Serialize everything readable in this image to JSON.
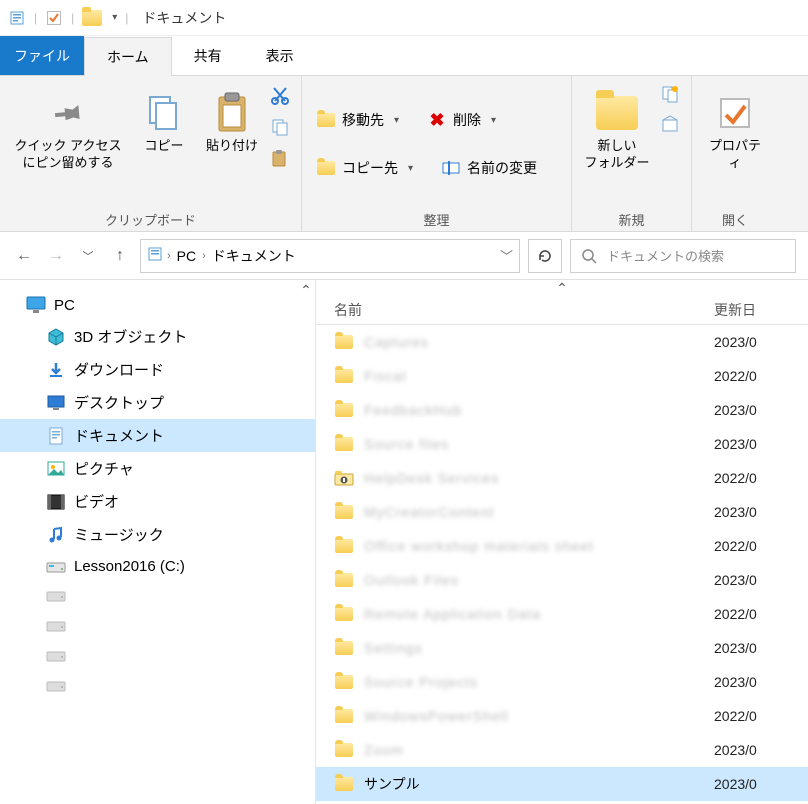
{
  "titlebar": {
    "title": "ドキュメント"
  },
  "tabs": {
    "file": "ファイル",
    "home": "ホーム",
    "share": "共有",
    "view": "表示"
  },
  "ribbon": {
    "clipboard": {
      "pin": "クイック アクセス\nにピン留めする",
      "copy": "コピー",
      "paste": "貼り付け",
      "group_label": "クリップボード"
    },
    "organize": {
      "move_to": "移動先",
      "copy_to": "コピー先",
      "delete": "削除",
      "rename": "名前の変更",
      "group_label": "整理"
    },
    "new": {
      "new_folder": "新しい\nフォルダー",
      "group_label": "新規"
    },
    "open": {
      "properties": "プロパティ",
      "group_label": "開く"
    }
  },
  "breadcrumb": {
    "root": "PC",
    "current": "ドキュメント"
  },
  "search": {
    "placeholder": "ドキュメントの検索"
  },
  "tree": {
    "pc": "PC",
    "items": [
      {
        "label": "3D オブジェクト",
        "icon": "cube"
      },
      {
        "label": "ダウンロード",
        "icon": "download"
      },
      {
        "label": "デスクトップ",
        "icon": "desktop"
      },
      {
        "label": "ドキュメント",
        "icon": "document",
        "selected": true
      },
      {
        "label": "ピクチャ",
        "icon": "pictures"
      },
      {
        "label": "ビデオ",
        "icon": "video"
      },
      {
        "label": "ミュージック",
        "icon": "music"
      },
      {
        "label": "Lesson2016 (C:)",
        "icon": "drive"
      },
      {
        "label": "",
        "icon": "drive-gray"
      },
      {
        "label": "",
        "icon": "drive-gray"
      },
      {
        "label": "",
        "icon": "drive-gray"
      },
      {
        "label": "",
        "icon": "drive-gray"
      }
    ]
  },
  "columns": {
    "name": "名前",
    "modified": "更新日"
  },
  "files": [
    {
      "name": "Captures",
      "date": "2023/0",
      "blurred": true,
      "icon": "folder"
    },
    {
      "name": "Fiscal",
      "date": "2022/0",
      "blurred": true,
      "icon": "folder"
    },
    {
      "name": "FeedbackHub",
      "date": "2023/0",
      "blurred": true,
      "icon": "folder"
    },
    {
      "name": "Source files",
      "date": "2023/0",
      "blurred": true,
      "icon": "folder"
    },
    {
      "name": "HelpDesk Services",
      "date": "2022/0",
      "blurred": true,
      "icon": "folder-special"
    },
    {
      "name": "MyCreatorContent",
      "date": "2023/0",
      "blurred": true,
      "icon": "folder"
    },
    {
      "name": "Office workshop materials sheet",
      "date": "2022/0",
      "blurred": true,
      "icon": "folder"
    },
    {
      "name": "Outlook Files",
      "date": "2023/0",
      "blurred": true,
      "icon": "folder"
    },
    {
      "name": "Remote Application Data",
      "date": "2022/0",
      "blurred": true,
      "icon": "folder"
    },
    {
      "name": "Settings",
      "date": "2023/0",
      "blurred": true,
      "icon": "folder"
    },
    {
      "name": "Source Projects",
      "date": "2023/0",
      "blurred": true,
      "icon": "folder"
    },
    {
      "name": "WindowsPowerShell",
      "date": "2022/0",
      "blurred": true,
      "icon": "folder"
    },
    {
      "name": "Zoom",
      "date": "2023/0",
      "blurred": true,
      "icon": "folder"
    },
    {
      "name": "サンプル",
      "date": "2023/0",
      "blurred": false,
      "icon": "folder",
      "selected": true
    }
  ]
}
